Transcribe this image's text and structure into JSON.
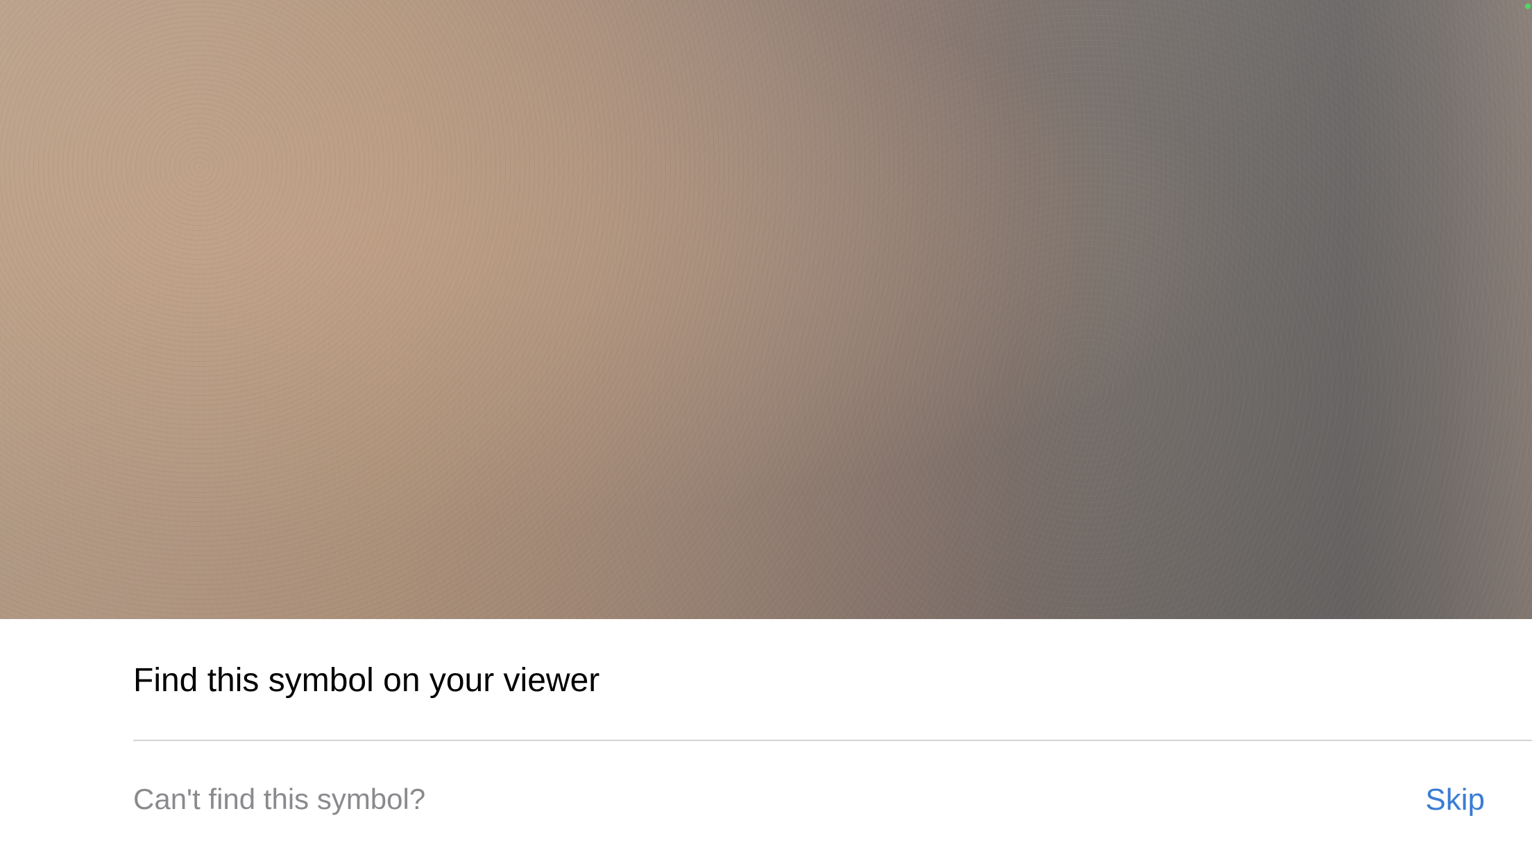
{
  "camera": {
    "label": "camera-preview"
  },
  "prompt": {
    "title": "Find this symbol on your viewer",
    "help_text": "Can't find this symbol?",
    "skip_label": "Skip"
  },
  "colors": {
    "accent": "#3a7cd5",
    "secondary_text": "#8a8a8e",
    "divider": "#d4d4d6",
    "status_indicator": "#4cd964"
  }
}
